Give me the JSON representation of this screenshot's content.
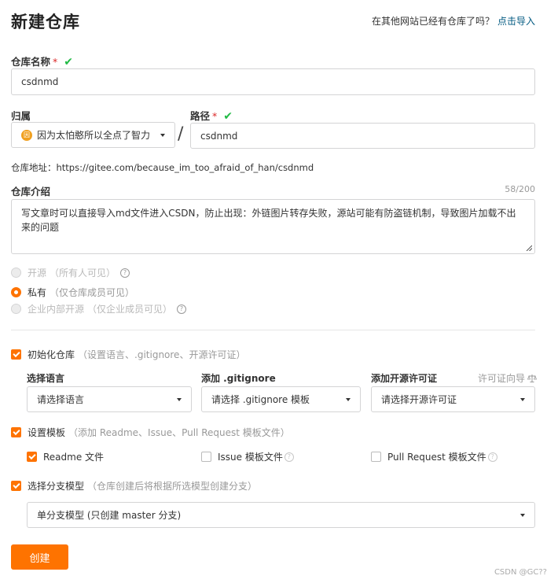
{
  "header": {
    "title": "新建仓库",
    "import_prefix": "在其他网站已经有仓库了吗？",
    "import_link": "点击导入"
  },
  "repo_name": {
    "label": "仓库名称",
    "required": "*",
    "check": "✔",
    "value": "csdnmd"
  },
  "owner": {
    "label": "归属",
    "avatar_text": "因",
    "value": "因为太怕憨所以全点了智力"
  },
  "slash": "/",
  "path": {
    "label": "路径",
    "required": "*",
    "check": "✔",
    "value": "csdnmd"
  },
  "repo_url": "仓库地址：https://gitee.com/because_im_too_afraid_of_han/csdnmd",
  "description": {
    "label": "仓库介绍",
    "counter": "58/200",
    "value": "写文章时可以直接导入md文件进入CSDN，防止出现：外链图片转存失败，源站可能有防盗链机制，导致图片加载不出来的问题"
  },
  "visibility": {
    "open_label": "开源",
    "open_hint": "（所有人可见）",
    "private_label": "私有",
    "private_hint": "（仅仓库成员可见）",
    "internal_label": "企业内部开源",
    "internal_hint": "（仅企业成员可见）",
    "selected": "private"
  },
  "init_repo": {
    "label": "初始化仓库",
    "hint": "（设置语言、.gitignore、开源许可证）",
    "checked": true,
    "language_label": "选择语言",
    "language_placeholder": "请选择语言",
    "gitignore_label": "添加 .gitignore",
    "gitignore_placeholder": "请选择 .gitignore 模板",
    "license_label": "添加开源许可证",
    "license_placeholder": "请选择开源许可证",
    "license_guide": "许可证向导"
  },
  "template": {
    "label": "设置模板",
    "hint": "（添加 Readme、Issue、Pull Request 模板文件）",
    "checked": true,
    "readme_label": "Readme 文件",
    "issue_label": "Issue 模板文件",
    "pr_label": "Pull Request 模板文件"
  },
  "branch": {
    "label": "选择分支模型",
    "hint": "（仓库创建后将根据所选模型创建分支）",
    "checked": true,
    "value": "单分支模型 (只创建 master 分支)"
  },
  "create_button": "创建",
  "watermark": "CSDN @GC??",
  "colors": {
    "accent": "#fe7300",
    "check_green": "#21ba45",
    "link": "#005980",
    "required": "#db2828"
  }
}
